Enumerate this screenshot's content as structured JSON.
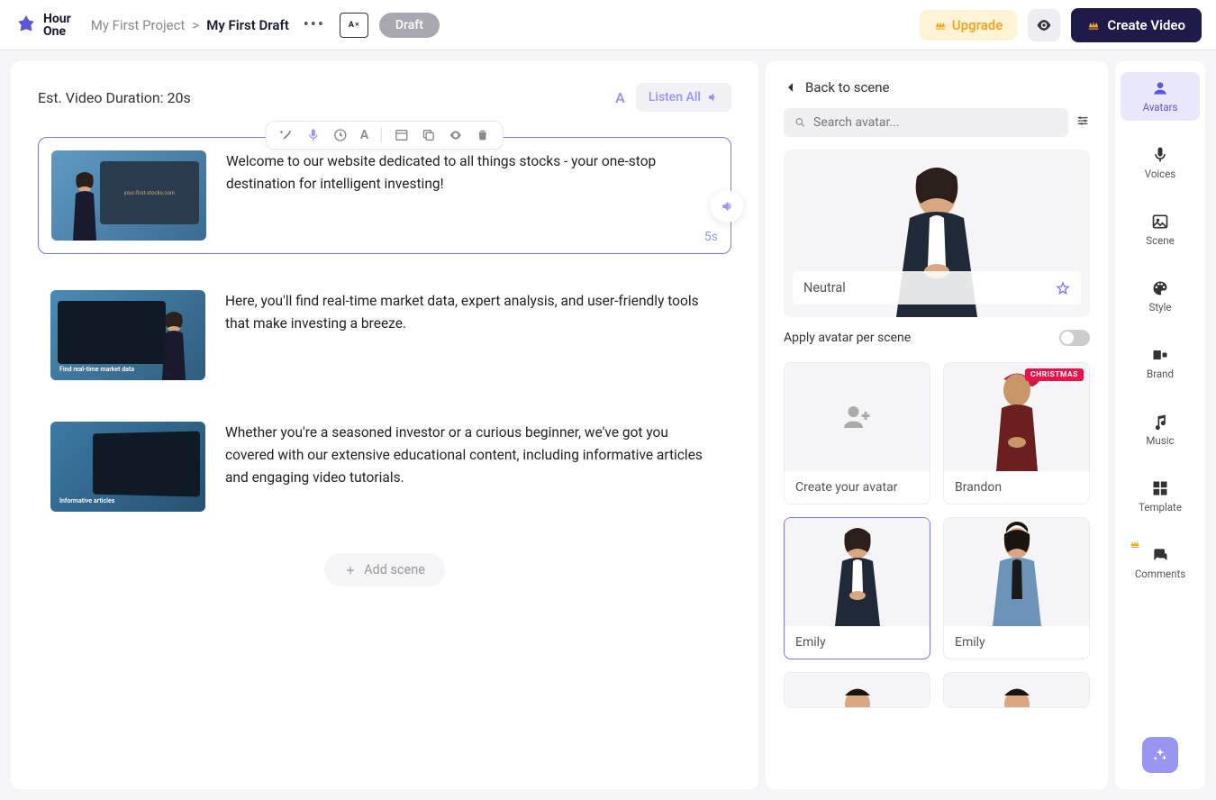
{
  "header": {
    "logo_text_1": "Hour",
    "logo_text_2": "One",
    "project": "My First Project",
    "separator": ">",
    "draft_name": "My First Draft",
    "draft_badge": "Draft",
    "lang_a": "A",
    "lang_x": "✕",
    "upgrade": "Upgrade",
    "create_video": "Create Video"
  },
  "editor": {
    "duration_label": "Est. Video Duration: 20s",
    "listen_all": "Listen All",
    "font_a": "A",
    "scenes": [
      {
        "text": "Welcome to our website dedicated to all things stocks - your one-stop destination for intelligent investing!",
        "duration": "5s",
        "caption": "your-first-stocks.com"
      },
      {
        "text": "Here, you'll find real-time market data, expert analysis, and user-friendly tools that make investing a breeze.",
        "caption": "Find real-time market data"
      },
      {
        "text": "Whether you're a seasoned investor or a curious beginner, we've got you covered with our extensive educational content, including informative articles and engaging video tutorials.",
        "caption": "Informative articles"
      }
    ],
    "add_scene": "Add scene"
  },
  "side": {
    "back": "Back to scene",
    "search_placeholder": "Search avatar...",
    "hero_label": "Neutral",
    "apply_label": "Apply avatar per scene",
    "avatars": {
      "create": "Create your avatar",
      "brandon": "Brandon",
      "christmas": "CHRISTMAS",
      "emily1": "Emily",
      "emily2": "Emily"
    }
  },
  "rail": {
    "avatars": "Avatars",
    "voices": "Voices",
    "scene": "Scene",
    "style": "Style",
    "brand": "Brand",
    "music": "Music",
    "template": "Template",
    "comments": "Comments"
  }
}
